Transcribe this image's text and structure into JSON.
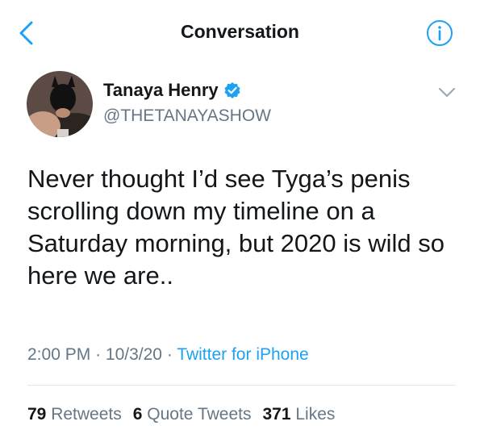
{
  "header": {
    "title": "Conversation"
  },
  "colors": {
    "accent": "#1da1f2",
    "muted": "#657786",
    "text": "#14171a"
  },
  "icons": {
    "back": "chevron-left-icon",
    "info": "info-icon",
    "verified": "verified-badge-icon",
    "more": "chevron-down-icon"
  },
  "tweet": {
    "author_name": "Tanaya Henry",
    "author_handle": "@THETANAYASHOW",
    "text": "Never thought I’d see Tyga’s penis scrolling down my timeline on a Saturday morning, but 2020 is wild so here we are..",
    "time": "2:00 PM",
    "date": "10/3/20",
    "client": "Twitter for iPhone",
    "sep": "·"
  },
  "stats": {
    "retweets_count": "79",
    "retweets_label": "Retweets",
    "quotes_count": "6",
    "quotes_label": "Quote Tweets",
    "likes_count": "371",
    "likes_label": "Likes"
  }
}
